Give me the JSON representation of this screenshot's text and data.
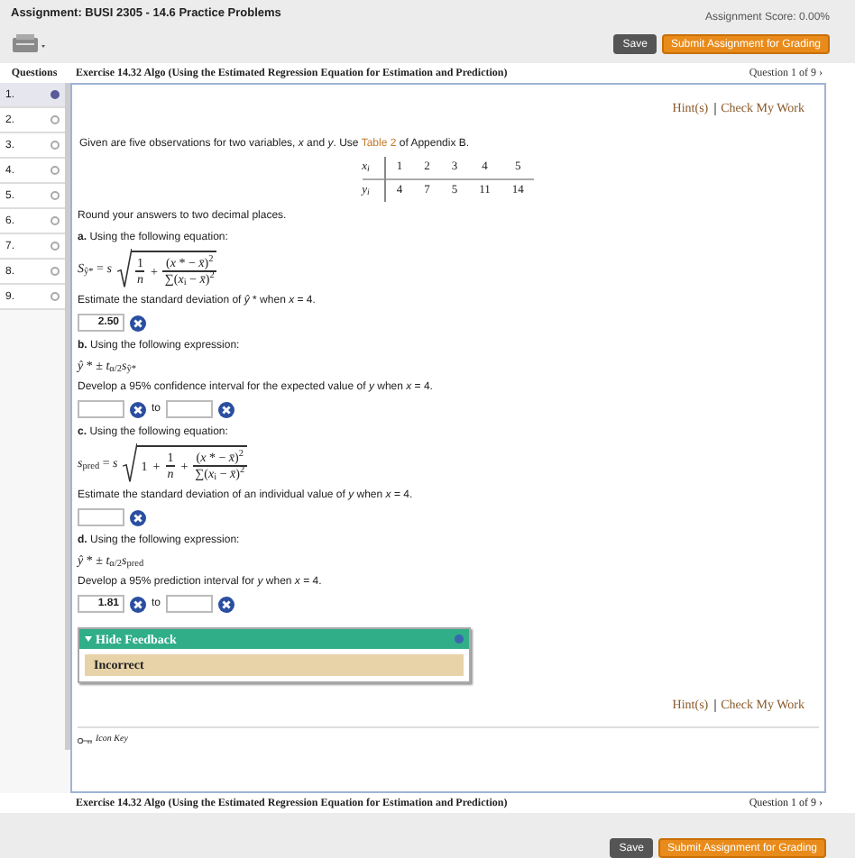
{
  "header": {
    "title": "Assignment: BUSI 2305 - 14.6 Practice Problems",
    "score": "Assignment Score: 0.00%",
    "save": "Save",
    "submit": "Submit Assignment for Grading"
  },
  "exercise_bar": {
    "heading": "Questions",
    "title": "Exercise 14.32 Algo (Using the Estimated Regression Equation for Estimation and Prediction)",
    "counter": "Question 1 of 9 ›"
  },
  "questions": [
    {
      "number": "1.",
      "selected": true
    },
    {
      "number": "2.",
      "selected": false
    },
    {
      "number": "3.",
      "selected": false
    },
    {
      "number": "4.",
      "selected": false
    },
    {
      "number": "5.",
      "selected": false
    },
    {
      "number": "6.",
      "selected": false
    },
    {
      "number": "7.",
      "selected": false
    },
    {
      "number": "8.",
      "selected": false
    },
    {
      "number": "9.",
      "selected": false
    }
  ],
  "top_links": [
    "Hint(s)",
    "Check My Work"
  ],
  "intro": {
    "before": "Given are five observations for two variables, *x* and *y*. Use",
    "link": "Table 2",
    "after": "of Appendix B."
  },
  "table": {
    "rows": [
      {
        "label": "*x*$_{i}$",
        "values": [
          "1",
          "2",
          "3",
          "4",
          "5"
        ]
      },
      {
        "label": "*y*$_{i}$",
        "values": [
          "4",
          "7",
          "5",
          "11",
          "14"
        ]
      }
    ]
  },
  "instruction": "Round your answers to two decimal places.",
  "parts": [
    {
      "letter": "a.",
      "prompt": "Using the following equation:",
      "formula": {
        "kind": "radical",
        "lhs": "*S*$_{ŷ*}$ = *s*",
        "terms": [
          {
            "kind": "fraction",
            "num": "1",
            "den": "*n*"
          },
          {
            "kind": "fraction",
            "operator": "+",
            "num": "(*x* * − *x̄*)$^{2}$",
            "den": "∑(*x*$_{i}$ − *x̄*)$^{2}$"
          }
        ]
      },
      "question": "Estimate the standard deviation of *ŷ* * when *x* = 4.",
      "inputs": [
        {
          "value": "2.50",
          "incorrect": true
        }
      ]
    },
    {
      "letter": "b.",
      "prompt": "Using the following expression:",
      "formula": {
        "kind": "inline",
        "text": "*ŷ* * ± *t*$_{α/2}$*s*$_{ŷ*}$"
      },
      "question": "Develop a 95% confidence interval for the expected value of *y* when *x* = 4.",
      "separator": "to",
      "inputs": [
        {
          "incorrect": true
        },
        {
          "incorrect": true
        }
      ]
    },
    {
      "letter": "c.",
      "prompt": "Using the following equation:",
      "formula": {
        "kind": "radical",
        "lhs": "*s*$_{pred}$ = *s*",
        "terms": [
          {
            "kind": "plain",
            "text": "1"
          },
          {
            "kind": "fraction",
            "operator": "+",
            "num": "1",
            "den": "*n*"
          },
          {
            "kind": "fraction",
            "operator": "+",
            "num": "(*x* * − *x̄*)$^{2}$",
            "den": "∑(*x*$_{i}$ − *x̄*)$^{2}$"
          }
        ]
      },
      "question": "Estimate the standard deviation of an individual value of *y* when *x* = 4.",
      "inputs": [
        {
          "incorrect": true
        }
      ]
    },
    {
      "letter": "d.",
      "prompt": "Using the following expression:",
      "formula": {
        "kind": "inline",
        "text": "*ŷ* * ± *t*$_{α/2}$*s*$_{pred}$"
      },
      "question": "Develop a 95% prediction interval for *y* when *x* = 4.",
      "separator": "to",
      "inputs": [
        {
          "value": "1.81",
          "incorrect": true
        },
        {
          "incorrect": true
        }
      ]
    }
  ],
  "feedback": {
    "toggle": "Hide Feedback",
    "expanded": true,
    "result": "Incorrect"
  },
  "bottom_links": [
    "Hint(s)",
    "Check My Work"
  ],
  "icon_key": "Icon Key",
  "footer": {
    "title": "Exercise 14.32 Algo (Using the Estimated Regression Equation for Estimation and Prediction)",
    "counter": "Question 1 of 9 ›",
    "save": "Save",
    "submit": "Submit Assignment for Grading"
  }
}
